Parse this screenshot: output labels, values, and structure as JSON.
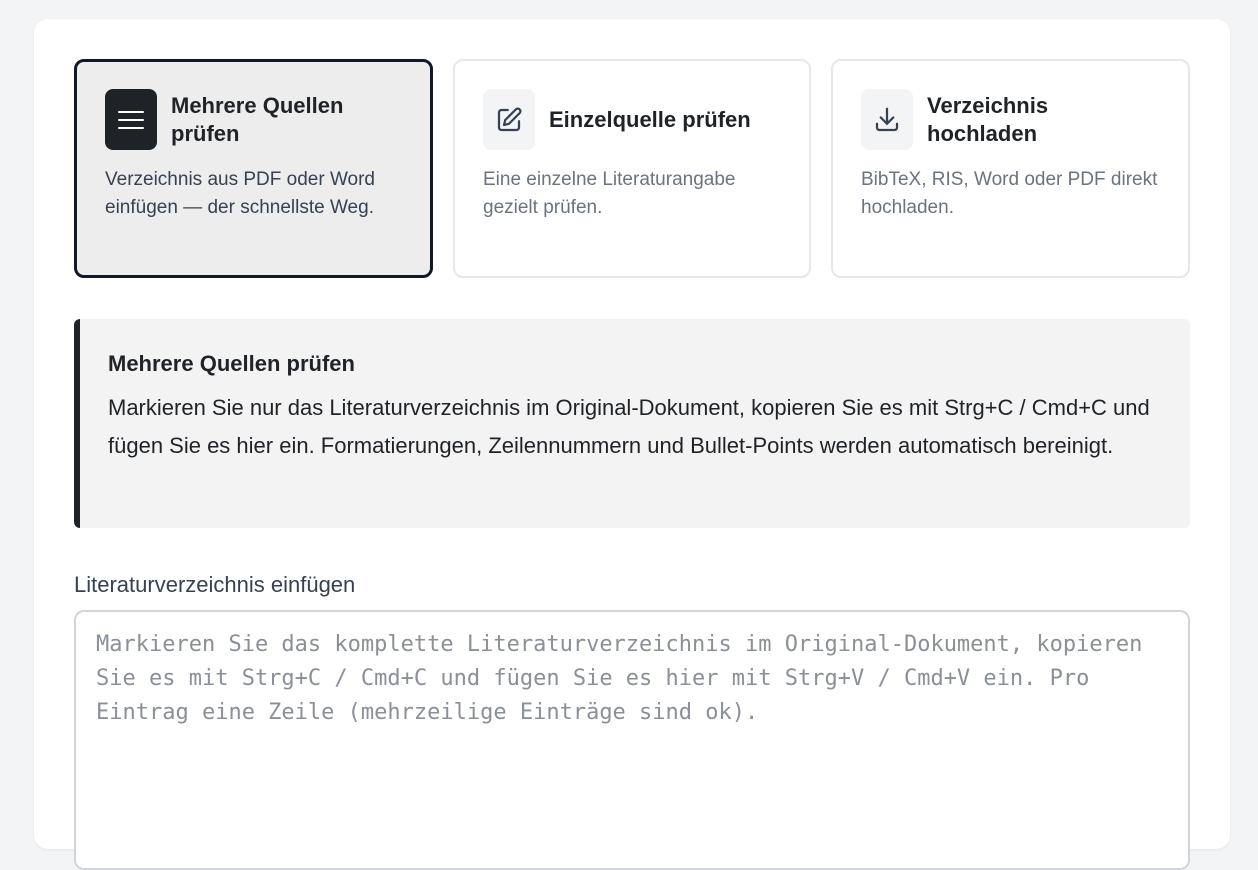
{
  "modes": [
    {
      "title": "Mehrere Quellen prüfen",
      "description": "Verzeichnis aus PDF oder Word einfügen — der schnellste Weg.",
      "icon": "menu-icon",
      "selected": true
    },
    {
      "title": "Einzelquelle prüfen",
      "description": "Eine einzelne Literaturangabe gezielt prüfen.",
      "icon": "edit-icon",
      "selected": false
    },
    {
      "title": "Verzeichnis hochladen",
      "description": "BibTeX, RIS, Word oder PDF direkt hochladen.",
      "icon": "download-icon",
      "selected": false
    }
  ],
  "info": {
    "title": "Mehrere Quellen prüfen",
    "text": "Markieren Sie nur das Literaturverzeichnis im Original-Dokument, kopieren Sie es mit Strg+C / Cmd+C und fügen Sie es hier ein. Formatierungen, Zeilennummern und Bullet-Points werden automatisch bereinigt."
  },
  "input": {
    "label": "Literaturverzeichnis einfügen",
    "value": "",
    "placeholder": "Markieren Sie das komplette Literaturverzeichnis im Original-Dokument, kopieren Sie es mit Strg+C / Cmd+C und fügen Sie es hier mit Strg+V / Cmd+V ein. Pro Eintrag eine Zeile (mehrzeilige Einträge sind ok)."
  },
  "colors": {
    "accent": "#1f2328",
    "selected_card_bg": "#ededed",
    "info_bg": "#f3f3f3"
  }
}
